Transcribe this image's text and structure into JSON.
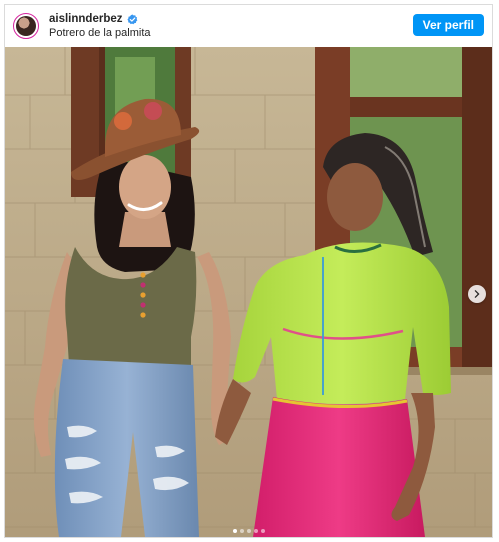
{
  "post": {
    "username": "aislinnderbez",
    "location": "Potrero de la palmita",
    "verified": true,
    "follow_label": "Ver perfil",
    "accent_color": "#0095f6"
  },
  "carousel": {
    "total_slides": 5,
    "active_slide": 1
  },
  "icons": [
    "verified-badge-icon",
    "chevron-right-icon",
    "avatar"
  ]
}
